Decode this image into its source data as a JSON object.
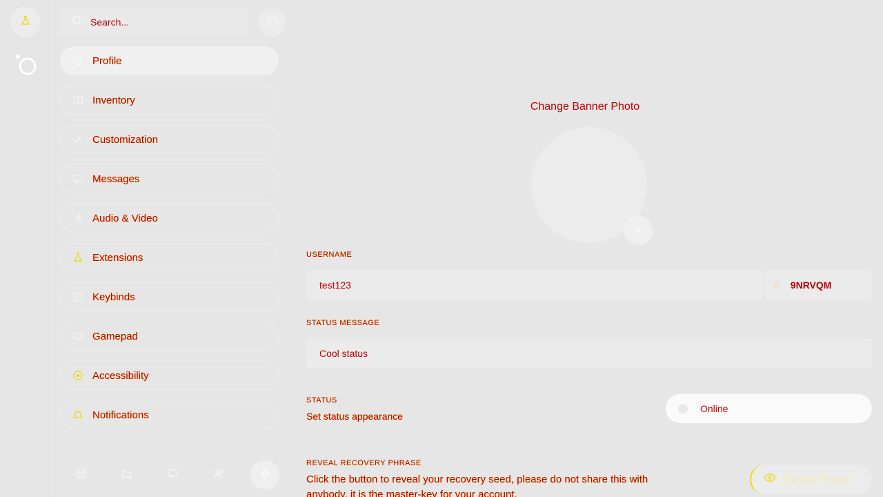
{
  "search": {
    "placeholder": "Search..."
  },
  "sidebar": {
    "items": [
      {
        "label": "Profile",
        "icon": "user-circle-icon"
      },
      {
        "label": "Inventory",
        "icon": "inventory-icon"
      },
      {
        "label": "Customization",
        "icon": "brush-icon"
      },
      {
        "label": "Messages",
        "icon": "message-icon"
      },
      {
        "label": "Audio & Video",
        "icon": "speaker-icon"
      },
      {
        "label": "Extensions",
        "icon": "flask-icon"
      },
      {
        "label": "Keybinds",
        "icon": "keyboard-icon"
      },
      {
        "label": "Gamepad",
        "icon": "gamepad-icon"
      },
      {
        "label": "Accessibility",
        "icon": "accessibility-icon"
      },
      {
        "label": "Notifications",
        "icon": "bell-icon"
      }
    ]
  },
  "bottom_bar": {
    "icons": [
      "inbox-icon",
      "folder-icon",
      "chat-icon",
      "friends-icon",
      "settings-icon"
    ]
  },
  "profile": {
    "banner_title": "Change Banner Photo",
    "username_label": "USERNAME",
    "username_value": "test123",
    "tag_value": "9NRVQM",
    "status_message_label": "STATUS MESSAGE",
    "status_message_value": "Cool status",
    "status_label": "STATUS",
    "status_description": "Set status appearance",
    "status_value": "Online",
    "recovery_label": "REVEAL RECOVERY PHRASE",
    "recovery_description": "Click the button to reveal your recovery seed, please do not share this with anybody, it is the master-key for your account.",
    "reveal_button": "Reveal Phrase"
  },
  "colors": {
    "background": "#e6e6e6",
    "text": "#c00000",
    "highlight": "#e8d800"
  }
}
